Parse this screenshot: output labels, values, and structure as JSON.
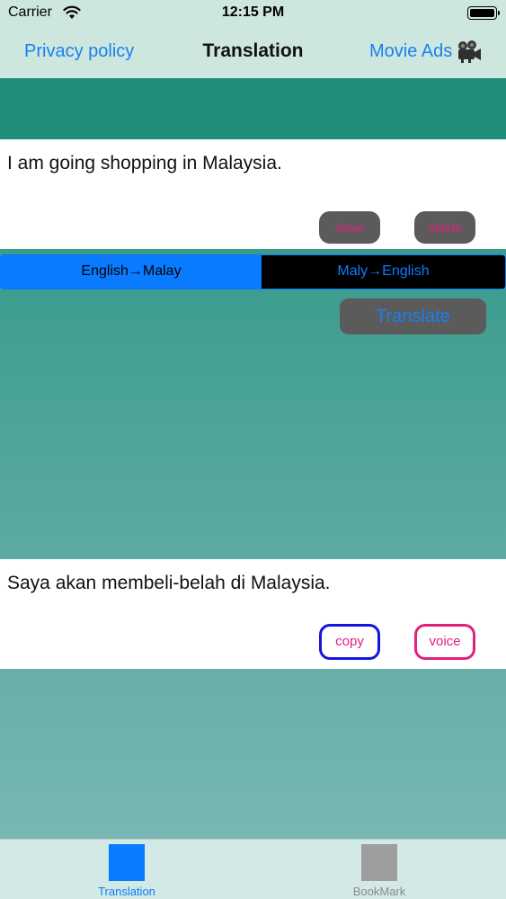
{
  "status_bar": {
    "carrier": "Carrier",
    "time": "12:15 PM",
    "icons": [
      "wifi-icon",
      "battery-icon"
    ]
  },
  "nav": {
    "left_link": "Privacy policy",
    "title": "Translation",
    "right_link": "Movie Ads",
    "right_icon": "camera-icon"
  },
  "input": {
    "text": "I am going shopping in Malaysia.",
    "save_label": "Save",
    "delete_label": "delete"
  },
  "direction": {
    "options": [
      "English→Malay",
      "Maly→English"
    ],
    "selected": "English→Malay"
  },
  "translate_label": "Translate",
  "output": {
    "text": "Saya akan membeli-belah di Malaysia.",
    "copy_label": "copy",
    "voice_label": "voice"
  },
  "tab_bar": {
    "items": [
      {
        "label": "Translation",
        "selected": true
      },
      {
        "label": "BookMark",
        "selected": false
      }
    ]
  },
  "colors": {
    "accent": "#0a7bff",
    "teal": "#208c7a",
    "button_gray": "#5b5b5b",
    "pink": "#e0217d",
    "copy_border": "#1414e0"
  }
}
